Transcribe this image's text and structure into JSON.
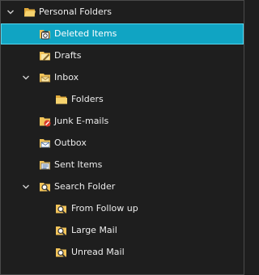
{
  "folder_tree": {
    "root": {
      "label": "Personal Folders",
      "icon": "folder-open-icon",
      "expanded": true
    },
    "items": [
      {
        "label": "Deleted Items",
        "icon": "deleted-items-folder-icon",
        "selected": true
      },
      {
        "label": "Drafts",
        "icon": "drafts-folder-icon"
      },
      {
        "label": "Inbox",
        "icon": "inbox-folder-icon",
        "expanded": true
      },
      {
        "label": "Folders",
        "icon": "folder-icon"
      },
      {
        "label": "Junk E-mails",
        "icon": "junk-folder-icon"
      },
      {
        "label": "Outbox",
        "icon": "outbox-folder-icon"
      },
      {
        "label": "Sent Items",
        "icon": "sent-items-folder-icon"
      },
      {
        "label": "Search Folder",
        "icon": "search-folder-icon",
        "expanded": true
      },
      {
        "label": "From Follow up",
        "icon": "search-folder-icon"
      },
      {
        "label": "Large Mail",
        "icon": "search-folder-icon"
      },
      {
        "label": "Unread Mail",
        "icon": "search-folder-icon"
      }
    ]
  },
  "colors": {
    "background": "#1e1e1e",
    "selection": "#10a4c3",
    "text": "#ececec",
    "folder": "#f2c45a"
  }
}
